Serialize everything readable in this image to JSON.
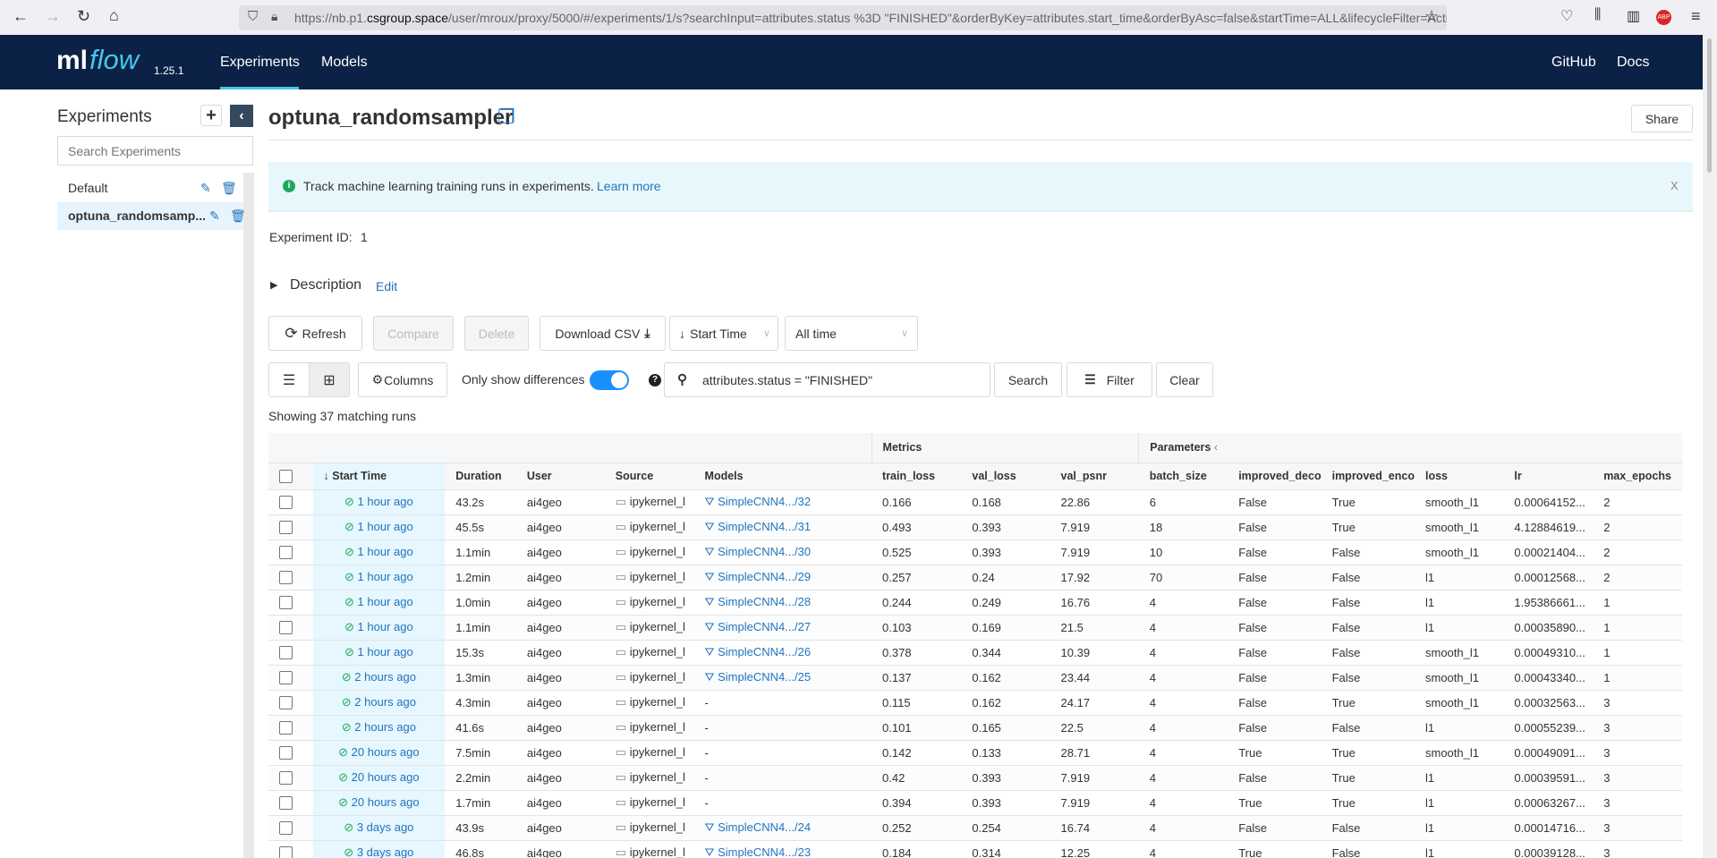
{
  "browser": {
    "url_pre": "https://nb.p1.",
    "url_domain": "csgroup.space",
    "url_post": "/user/mroux/proxy/5000/#/experiments/1/s?searchInput=attributes.status %3D \"FINISHED\"&orderByKey=attributes.start_time&orderByAsc=false&startTime=ALL&lifecycleFilter=Active&"
  },
  "nav": {
    "logo_ml": "ml",
    "logo_flow": "flow",
    "version": "1.25.1",
    "tabs": [
      "Experiments",
      "Models"
    ],
    "right": [
      "GitHub",
      "Docs"
    ]
  },
  "sidebar": {
    "title": "Experiments",
    "add": "+",
    "search_placeholder": "Search Experiments",
    "items": [
      {
        "label": "Default"
      },
      {
        "label": "optuna_randomsamp..."
      }
    ]
  },
  "main": {
    "title": "optuna_randomsampler",
    "share": "Share",
    "banner": {
      "text": "Track machine learning training runs in experiments.",
      "link": "Learn more",
      "close": "X"
    },
    "experiment_id_label": "Experiment ID:",
    "experiment_id": "1",
    "description": "Description",
    "edit": "Edit",
    "toolbar": {
      "refresh": "Refresh",
      "compare": "Compare",
      "delete": "Delete",
      "download": "Download CSV",
      "sort": "Start Time",
      "time": "All time"
    },
    "toolbar2": {
      "columns": "Columns",
      "diff": "Only show differences",
      "diff_on": true,
      "search_value": "attributes.status = \"FINISHED\"",
      "search": "Search",
      "filter": "Filter",
      "clear": "Clear"
    },
    "showing": "Showing 37 matching runs"
  },
  "table": {
    "groups": {
      "metrics": "Metrics",
      "params": "Parameters"
    },
    "columns": [
      "Start Time",
      "Duration",
      "User",
      "Source",
      "Models",
      "train_loss",
      "val_loss",
      "val_psnr",
      "batch_size",
      "improved_deco",
      "improved_enco",
      "loss",
      "lr",
      "max_epochs"
    ],
    "rows": [
      [
        "1 hour ago",
        "43.2s",
        "ai4geo",
        "ipykernel_l",
        "SimpleCNN4.../32",
        "0.166",
        "0.168",
        "22.86",
        "6",
        "False",
        "True",
        "smooth_l1",
        "0.00064152...",
        "2"
      ],
      [
        "1 hour ago",
        "45.5s",
        "ai4geo",
        "ipykernel_l",
        "SimpleCNN4.../31",
        "0.493",
        "0.393",
        "7.919",
        "18",
        "False",
        "True",
        "smooth_l1",
        "4.12884619...",
        "2"
      ],
      [
        "1 hour ago",
        "1.1min",
        "ai4geo",
        "ipykernel_l",
        "SimpleCNN4.../30",
        "0.525",
        "0.393",
        "7.919",
        "10",
        "False",
        "False",
        "smooth_l1",
        "0.00021404...",
        "2"
      ],
      [
        "1 hour ago",
        "1.2min",
        "ai4geo",
        "ipykernel_l",
        "SimpleCNN4.../29",
        "0.257",
        "0.24",
        "17.92",
        "70",
        "False",
        "False",
        "l1",
        "0.00012568...",
        "2"
      ],
      [
        "1 hour ago",
        "1.0min",
        "ai4geo",
        "ipykernel_l",
        "SimpleCNN4.../28",
        "0.244",
        "0.249",
        "16.76",
        "4",
        "False",
        "False",
        "l1",
        "1.95386661...",
        "1"
      ],
      [
        "1 hour ago",
        "1.1min",
        "ai4geo",
        "ipykernel_l",
        "SimpleCNN4.../27",
        "0.103",
        "0.169",
        "21.5",
        "4",
        "False",
        "False",
        "l1",
        "0.00035890...",
        "1"
      ],
      [
        "1 hour ago",
        "15.3s",
        "ai4geo",
        "ipykernel_l",
        "SimpleCNN4.../26",
        "0.378",
        "0.344",
        "10.39",
        "4",
        "False",
        "False",
        "smooth_l1",
        "0.00049310...",
        "1"
      ],
      [
        "2 hours ago",
        "1.3min",
        "ai4geo",
        "ipykernel_l",
        "SimpleCNN4.../25",
        "0.137",
        "0.162",
        "23.44",
        "4",
        "False",
        "False",
        "smooth_l1",
        "0.00043340...",
        "1"
      ],
      [
        "2 hours ago",
        "4.3min",
        "ai4geo",
        "ipykernel_l",
        "-",
        "0.115",
        "0.162",
        "24.17",
        "4",
        "False",
        "True",
        "smooth_l1",
        "0.00032563...",
        "3"
      ],
      [
        "2 hours ago",
        "41.6s",
        "ai4geo",
        "ipykernel_l",
        "-",
        "0.101",
        "0.165",
        "22.5",
        "4",
        "False",
        "False",
        "l1",
        "0.00055239...",
        "3"
      ],
      [
        "20 hours ago",
        "7.5min",
        "ai4geo",
        "ipykernel_l",
        "-",
        "0.142",
        "0.133",
        "28.71",
        "4",
        "True",
        "True",
        "smooth_l1",
        "0.00049091...",
        "3"
      ],
      [
        "20 hours ago",
        "2.2min",
        "ai4geo",
        "ipykernel_l",
        "-",
        "0.42",
        "0.393",
        "7.919",
        "4",
        "False",
        "True",
        "l1",
        "0.00039591...",
        "3"
      ],
      [
        "20 hours ago",
        "1.7min",
        "ai4geo",
        "ipykernel_l",
        "-",
        "0.394",
        "0.393",
        "7.919",
        "4",
        "True",
        "True",
        "l1",
        "0.00063267...",
        "3"
      ],
      [
        "3 days ago",
        "43.9s",
        "ai4geo",
        "ipykernel_l",
        "SimpleCNN4.../24",
        "0.252",
        "0.254",
        "16.74",
        "4",
        "False",
        "False",
        "l1",
        "0.00014716...",
        "3"
      ],
      [
        "3 days ago",
        "46.8s",
        "ai4geo",
        "ipykernel_l",
        "SimpleCNN4.../23",
        "0.184",
        "0.314",
        "12.25",
        "4",
        "True",
        "False",
        "l1",
        "0.00039128...",
        "3"
      ]
    ]
  },
  "colors": {
    "nav": "#0b2145",
    "accent": "#2374bb",
    "banner": "#e8f7fc",
    "sorted_col": "#e6f7ff",
    "toggle": "#1890ff"
  }
}
